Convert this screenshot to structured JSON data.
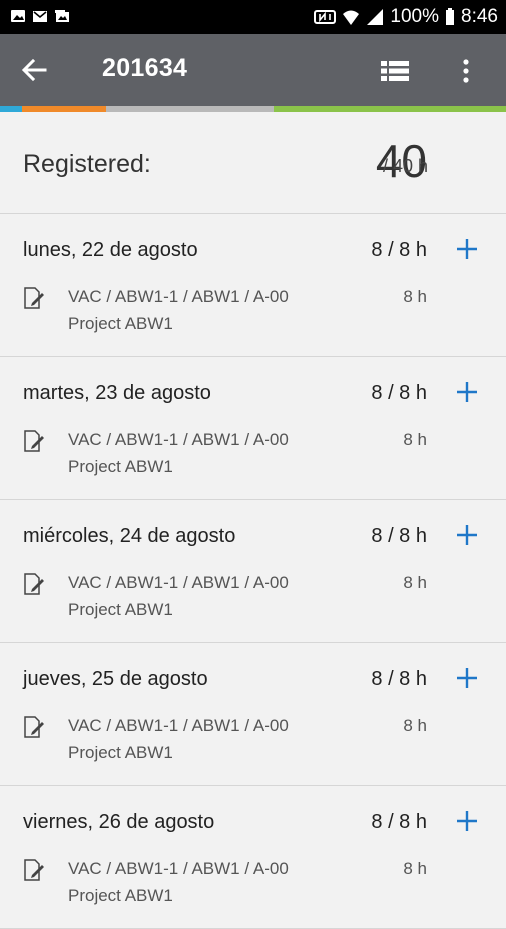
{
  "status_bar": {
    "battery": "100%",
    "time": "8:46"
  },
  "app_bar": {
    "title": "201634"
  },
  "colors": {
    "app_bar": "#5f6166",
    "accent_blue": "#1f77c8",
    "bar_segments": [
      "#2fa9d8",
      "#f08a2a",
      "#b9b9b9",
      "#8bc34a"
    ]
  },
  "summary": {
    "label": "Registered:",
    "registered": "40",
    "total": "/ 40 h"
  },
  "days": [
    {
      "date": "lunes, 22 de agosto",
      "hours": "8 / 8 h",
      "entry": {
        "path": "VAC / ABW1-1 / ABW1 / A-00",
        "hours": "8 h",
        "project": "Project  ABW1"
      }
    },
    {
      "date": "martes, 23 de agosto",
      "hours": "8 / 8 h",
      "entry": {
        "path": "VAC / ABW1-1 / ABW1 / A-00",
        "hours": "8 h",
        "project": "Project  ABW1"
      }
    },
    {
      "date": "miércoles, 24 de agosto",
      "hours": "8 / 8 h",
      "entry": {
        "path": "VAC / ABW1-1 / ABW1 / A-00",
        "hours": "8 h",
        "project": "Project  ABW1"
      }
    },
    {
      "date": "jueves, 25 de agosto",
      "hours": "8 / 8 h",
      "entry": {
        "path": "VAC / ABW1-1 / ABW1 / A-00",
        "hours": "8 h",
        "project": "Project  ABW1"
      }
    },
    {
      "date": "viernes, 26 de agosto",
      "hours": "8 / 8 h",
      "entry": {
        "path": "VAC / ABW1-1 / ABW1 / A-00",
        "hours": "8 h",
        "project": "Project  ABW1"
      }
    }
  ]
}
